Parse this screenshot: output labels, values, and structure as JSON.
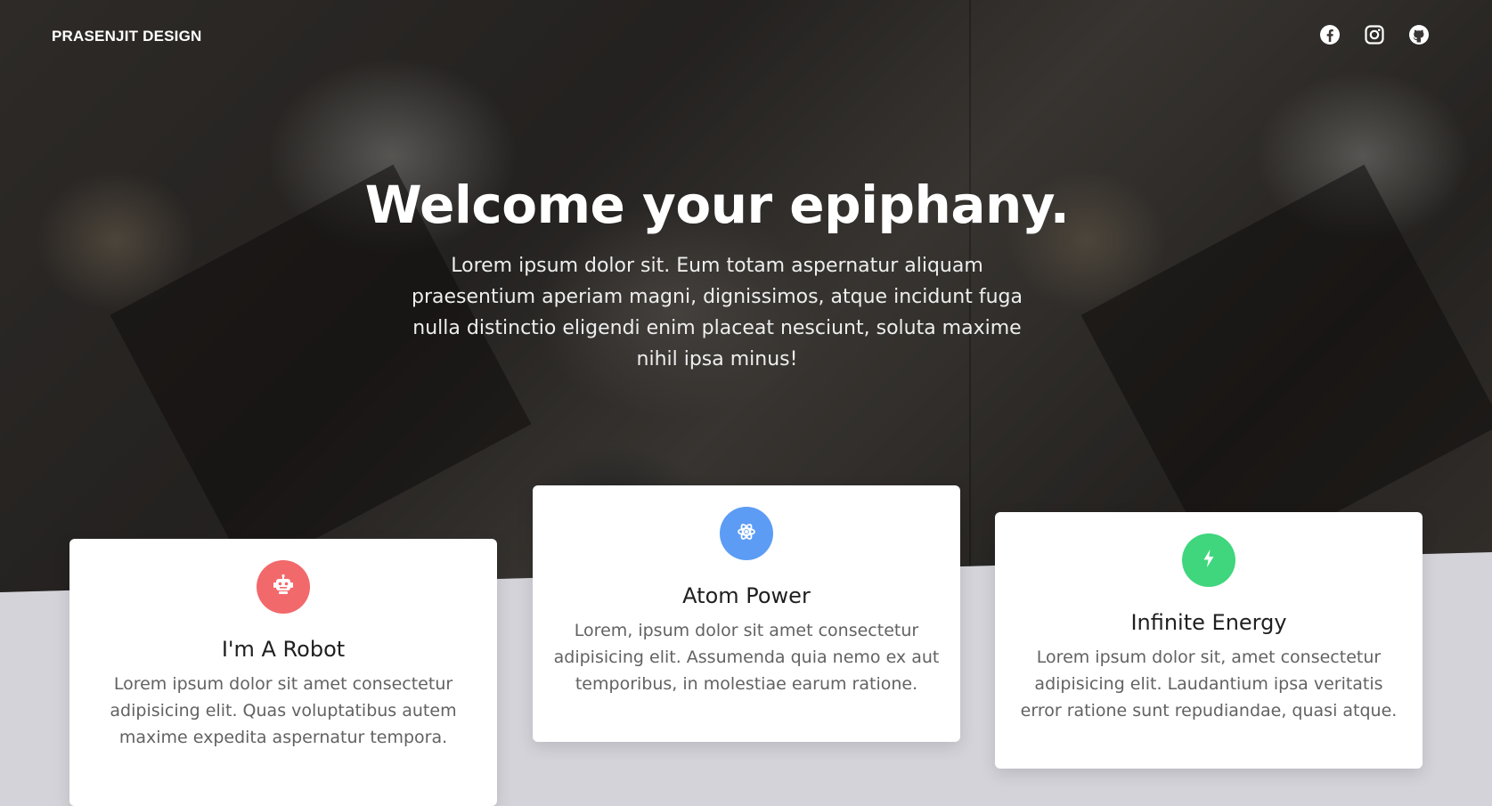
{
  "nav": {
    "brand": "PRASENJIT DESIGN",
    "social": [
      {
        "icon": "facebook-icon"
      },
      {
        "icon": "instagram-icon"
      },
      {
        "icon": "github-icon"
      }
    ]
  },
  "hero": {
    "headline": "Welcome your epiphany.",
    "lead": "Lorem ipsum dolor sit. Eum totam aspernatur aliquam praesentium aperiam magni, dignissimos, atque incidunt fuga nulla distinctio eligendi enim placeat nesciunt, soluta maxime nihil ipsa minus!"
  },
  "cards": [
    {
      "icon": "robot-icon",
      "color": "#f2696b",
      "title": "I'm A Robot",
      "desc": "Lorem ipsum dolor sit amet consectetur adipisicing elit. Quas voluptatibus autem maxime expedita aspernatur tempora."
    },
    {
      "icon": "atom-icon",
      "color": "#5c9cf5",
      "title": "Atom Power",
      "desc": "Lorem, ipsum dolor sit amet consectetur adipisicing elit. Assumenda quia nemo ex aut temporibus, in molestiae earum ratione."
    },
    {
      "icon": "lightning-bolt-icon",
      "color": "#3fd67d",
      "title": "Infinite Energy",
      "desc": "Lorem ipsum dolor sit, amet consectetur adipisicing elit. Laudantium ipsa veritatis error ratione sunt repudiandae, quasi atque."
    }
  ]
}
